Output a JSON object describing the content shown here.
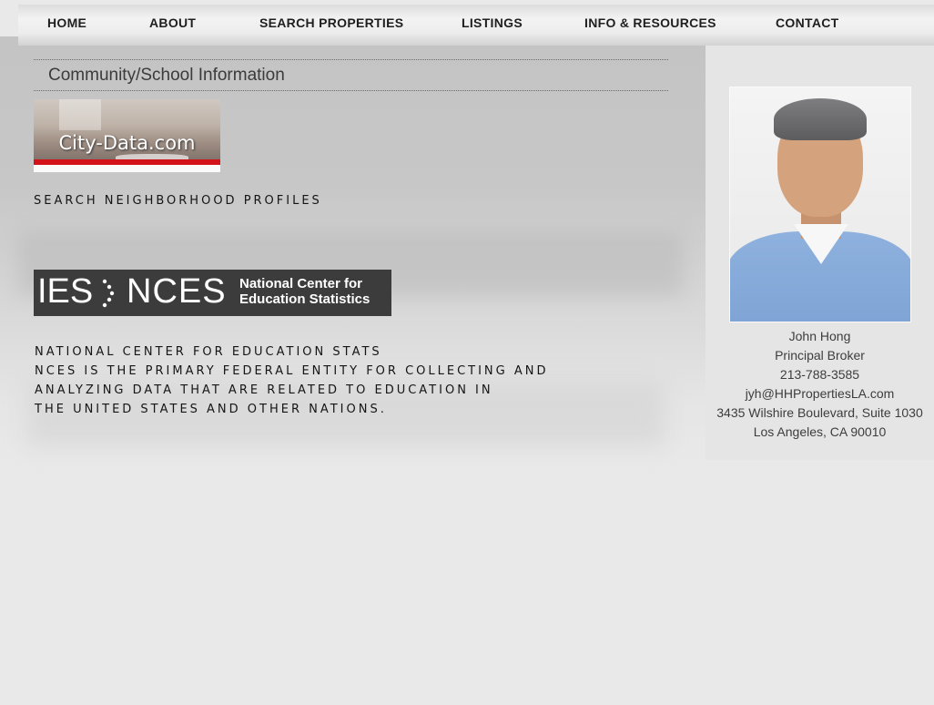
{
  "nav": {
    "items": [
      {
        "label": "HOME"
      },
      {
        "label": "ABOUT"
      },
      {
        "label": "SEARCH PROPERTIES"
      },
      {
        "label": "LISTINGS"
      },
      {
        "label": "INFO & RESOURCES"
      },
      {
        "label": "CONTACT"
      }
    ]
  },
  "main": {
    "section_title": "Community/School Information",
    "citydata_logo": {
      "text": "City-Data.com"
    },
    "search_link": "SEARCH NEIGHBORHOOD PROFILES",
    "nces_logo": {
      "short1": "IES",
      "short2": "NCES",
      "full_line1": "National Center for",
      "full_line2": "Education Statistics"
    },
    "nces_description": [
      "NATIONAL CENTER FOR EDUCATION STATS",
      "NCES IS THE PRIMARY FEDERAL ENTITY FOR COLLECTING AND",
      "ANALYZING DATA THAT ARE RELATED TO EDUCATION IN",
      "THE UNITED STATES AND OTHER NATIONS."
    ]
  },
  "sidebar": {
    "agent": {
      "name": "John Hong",
      "title": "Principal Broker",
      "phone": "213-788-3585",
      "email": "jyh@HHPropertiesLA.com",
      "address1": "3435 Wilshire Boulevard, Suite 1030",
      "address2": "Los Angeles, CA 90010"
    }
  }
}
